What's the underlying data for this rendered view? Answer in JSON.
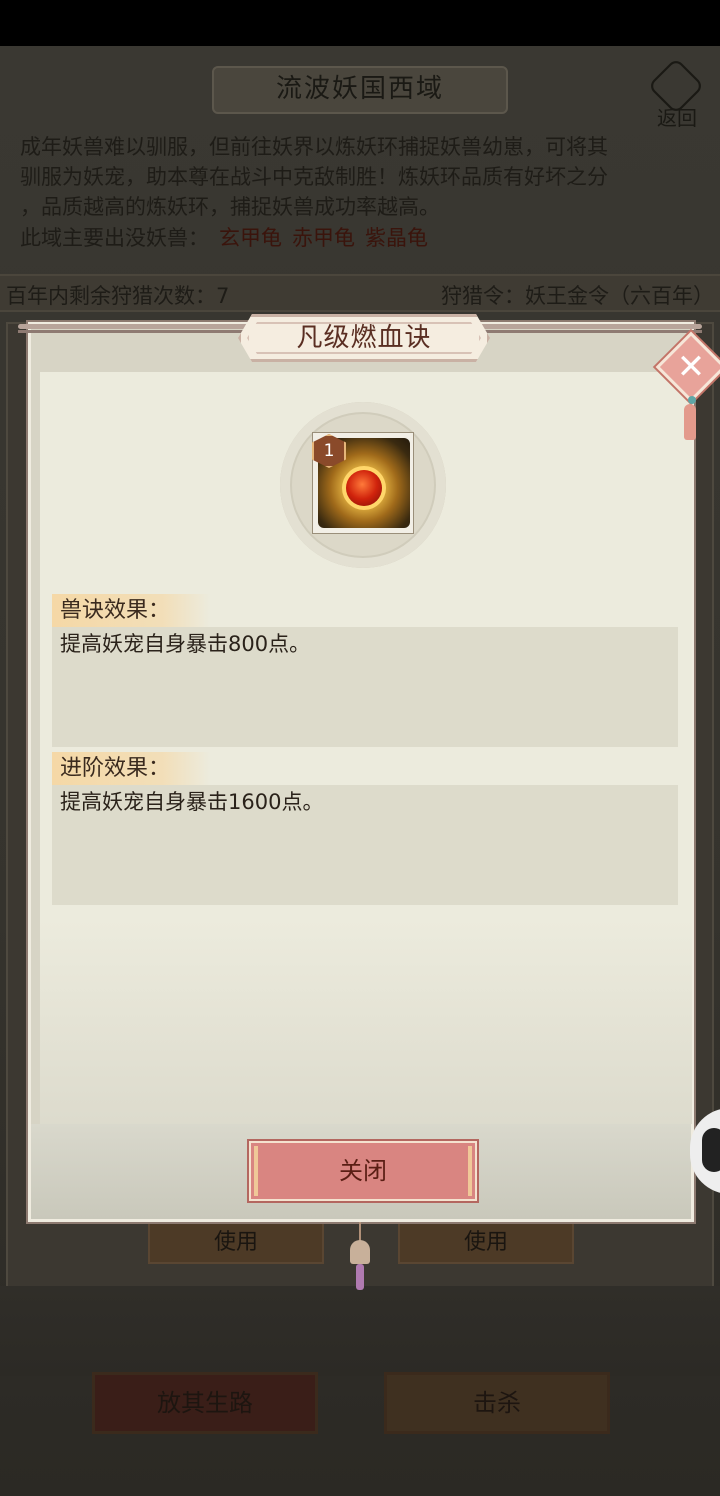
{
  "background": {
    "title": "流波妖国西域",
    "back_label": "返回",
    "description_lines": [
      "成年妖兽难以驯服，但前往妖界以炼妖环捕捉妖兽幼崽，可将其",
      "驯服为妖宠，助本尊在战斗中克敌制胜！炼妖环品质有好坏之分",
      "，品质越高的炼妖环，捕捉妖兽成功率越高。"
    ],
    "beasts_prefix": "此域主要出没妖兽：",
    "beasts": [
      "玄甲龟",
      "赤甲龟",
      "紫晶龟"
    ],
    "remaining_hunts": "百年内剩余狩猎次数：7",
    "hunt_token": "狩猎令：妖王金令（六百年）",
    "use_buttons": [
      "使用",
      "使用"
    ],
    "release_button": "放其生路",
    "kill_button": "击杀"
  },
  "dialog": {
    "title": "凡级燃血诀",
    "skill_level": "1",
    "sections": [
      {
        "label": "兽诀效果：",
        "text": "提高妖宠自身暴击800点。"
      },
      {
        "label": "进阶效果：",
        "text": "提高妖宠自身暴击1600点。"
      }
    ],
    "close_button": "关闭"
  },
  "colors": {
    "dialog_bg": "#ecebdd",
    "close_button": "#d98581",
    "title_text": "#5a2e22"
  }
}
